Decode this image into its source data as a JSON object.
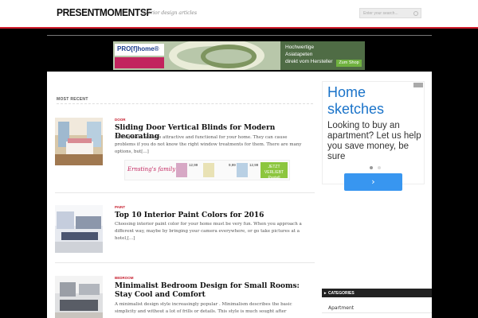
{
  "header": {
    "logo": "PRESENTMOMENTSF",
    "tagline": "Interior design articles",
    "search_placeholder": "Enter your search..."
  },
  "top_banner": {
    "brand": "PRO[f]home®",
    "text": "Hochwertige\nAsiatapeten\ndirekt vom Hersteller",
    "shop_label": "Zum Shop"
  },
  "main": {
    "section_title": "MOST RECENT",
    "posts": [
      {
        "category": "DOOR",
        "title": "Sliding Door Vertical Blinds for Modern Decorating",
        "excerpt": "Sliding door looks so attractive and functional for your home. They can cause problems if you do not know the right window treatments for them. There are many options, but[...]"
      },
      {
        "category": "PAINT",
        "title": "Top 10 Interior Paint Colors for 2016",
        "excerpt": "Choosing interior paint color for your home must be very fun. When you approach a different way, maybe by bringing your camera everywhere, or go take pictures at a hotel,[...]"
      },
      {
        "category": "BEDROOM",
        "title": "Minimalist Bedroom Design for Small Rooms: Stay Cool and Comfort",
        "excerpt": "A minimalist design style increasingly popular . Minimalism describes the basic simplicity and without a lot of frills or details. This style is much sought after"
      }
    ],
    "inline_ad": {
      "brand": "Ernsting's family",
      "prices": [
        "12,99",
        "9,99",
        "12,99"
      ],
      "badge": "JETZT VERLIEBT Pastell"
    }
  },
  "sidebar": {
    "ad": {
      "title": "Home sketches",
      "body": "Looking to buy an apartment? Let us help you save money, be sure",
      "button": "›"
    },
    "categories_title": "CATEGORIES",
    "categories": [
      "Apartment"
    ]
  },
  "colors": {
    "accent_red": "#d11b2b",
    "category_red": "#c61d2c",
    "ad_blue": "#1a73c9",
    "ad_button": "#3896f0"
  }
}
